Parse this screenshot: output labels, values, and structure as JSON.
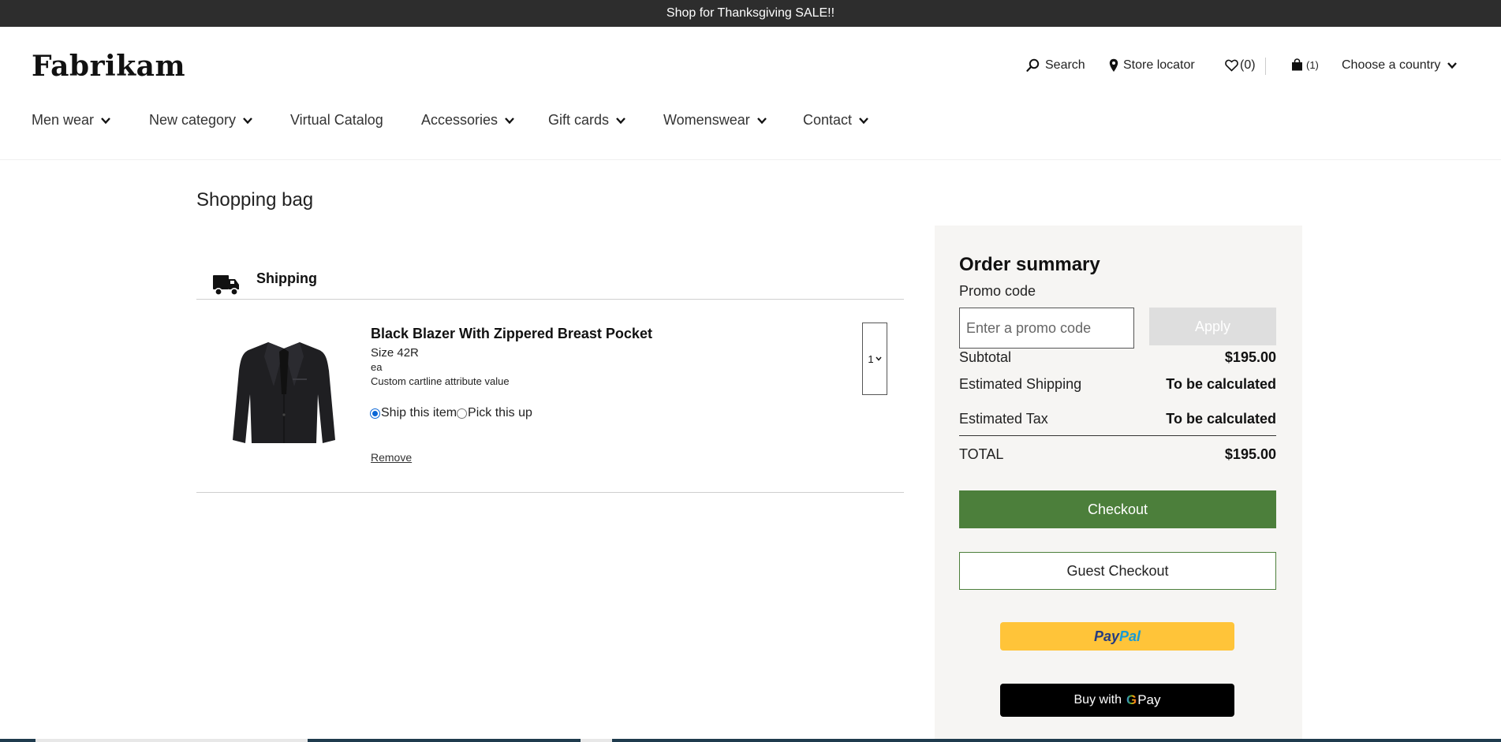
{
  "promo_banner": "Shop for Thanksgiving SALE!!",
  "brand": {
    "logo_text": "Fabrikam"
  },
  "utility": {
    "search_label": "Search",
    "store_locator_label": "Store locator",
    "wishlist_count": "(0)",
    "cart_count": "(1)",
    "country_label": "Choose a country"
  },
  "nav": {
    "items": [
      {
        "label": "Men wear",
        "has_dropdown": true
      },
      {
        "label": "New category",
        "has_dropdown": true
      },
      {
        "label": "Virtual Catalog",
        "has_dropdown": false
      },
      {
        "label": "Accessories",
        "has_dropdown": true
      },
      {
        "label": "Gift cards",
        "has_dropdown": true
      },
      {
        "label": "Womenswear",
        "has_dropdown": true
      },
      {
        "label": "Contact",
        "has_dropdown": true
      }
    ]
  },
  "page": {
    "title": "Shopping bag"
  },
  "shipping_group": {
    "title": "Shipping",
    "icon": "truck-icon"
  },
  "cart_line": {
    "name": "Black Blazer With Zippered Breast Pocket",
    "size": "Size 42R",
    "unit": "ea",
    "custom_attribute": "Custom cartline attribute value",
    "delivery_options": [
      {
        "label": "Ship this item",
        "selected": true
      },
      {
        "label": "Pick this up",
        "selected": false
      }
    ],
    "remove_label": "Remove",
    "quantity": "1"
  },
  "summary": {
    "title": "Order summary",
    "promo_label": "Promo code",
    "promo_placeholder": "Enter a promo code",
    "apply_label": "Apply",
    "subtotal_label": "Subtotal",
    "subtotal_value": "$195.00",
    "shipping_label": "Estimated Shipping",
    "shipping_value": "To be calculated",
    "tax_label": "Estimated Tax",
    "tax_value": "To be calculated",
    "total_label": "TOTAL",
    "total_value": "$195.00",
    "checkout_label": "Checkout",
    "guest_checkout_label": "Guest Checkout",
    "paypal_part1": "Pay",
    "paypal_part2": "Pal",
    "gpay_prefix": "Buy with",
    "gpay_g": "G",
    "gpay_pay": "Pay"
  },
  "colors": {
    "promo_bar": "#2d2d2d",
    "checkout_green": "#4c7f3b",
    "summary_bg": "#f6f5f3",
    "paypal_yellow": "#ffc439"
  }
}
